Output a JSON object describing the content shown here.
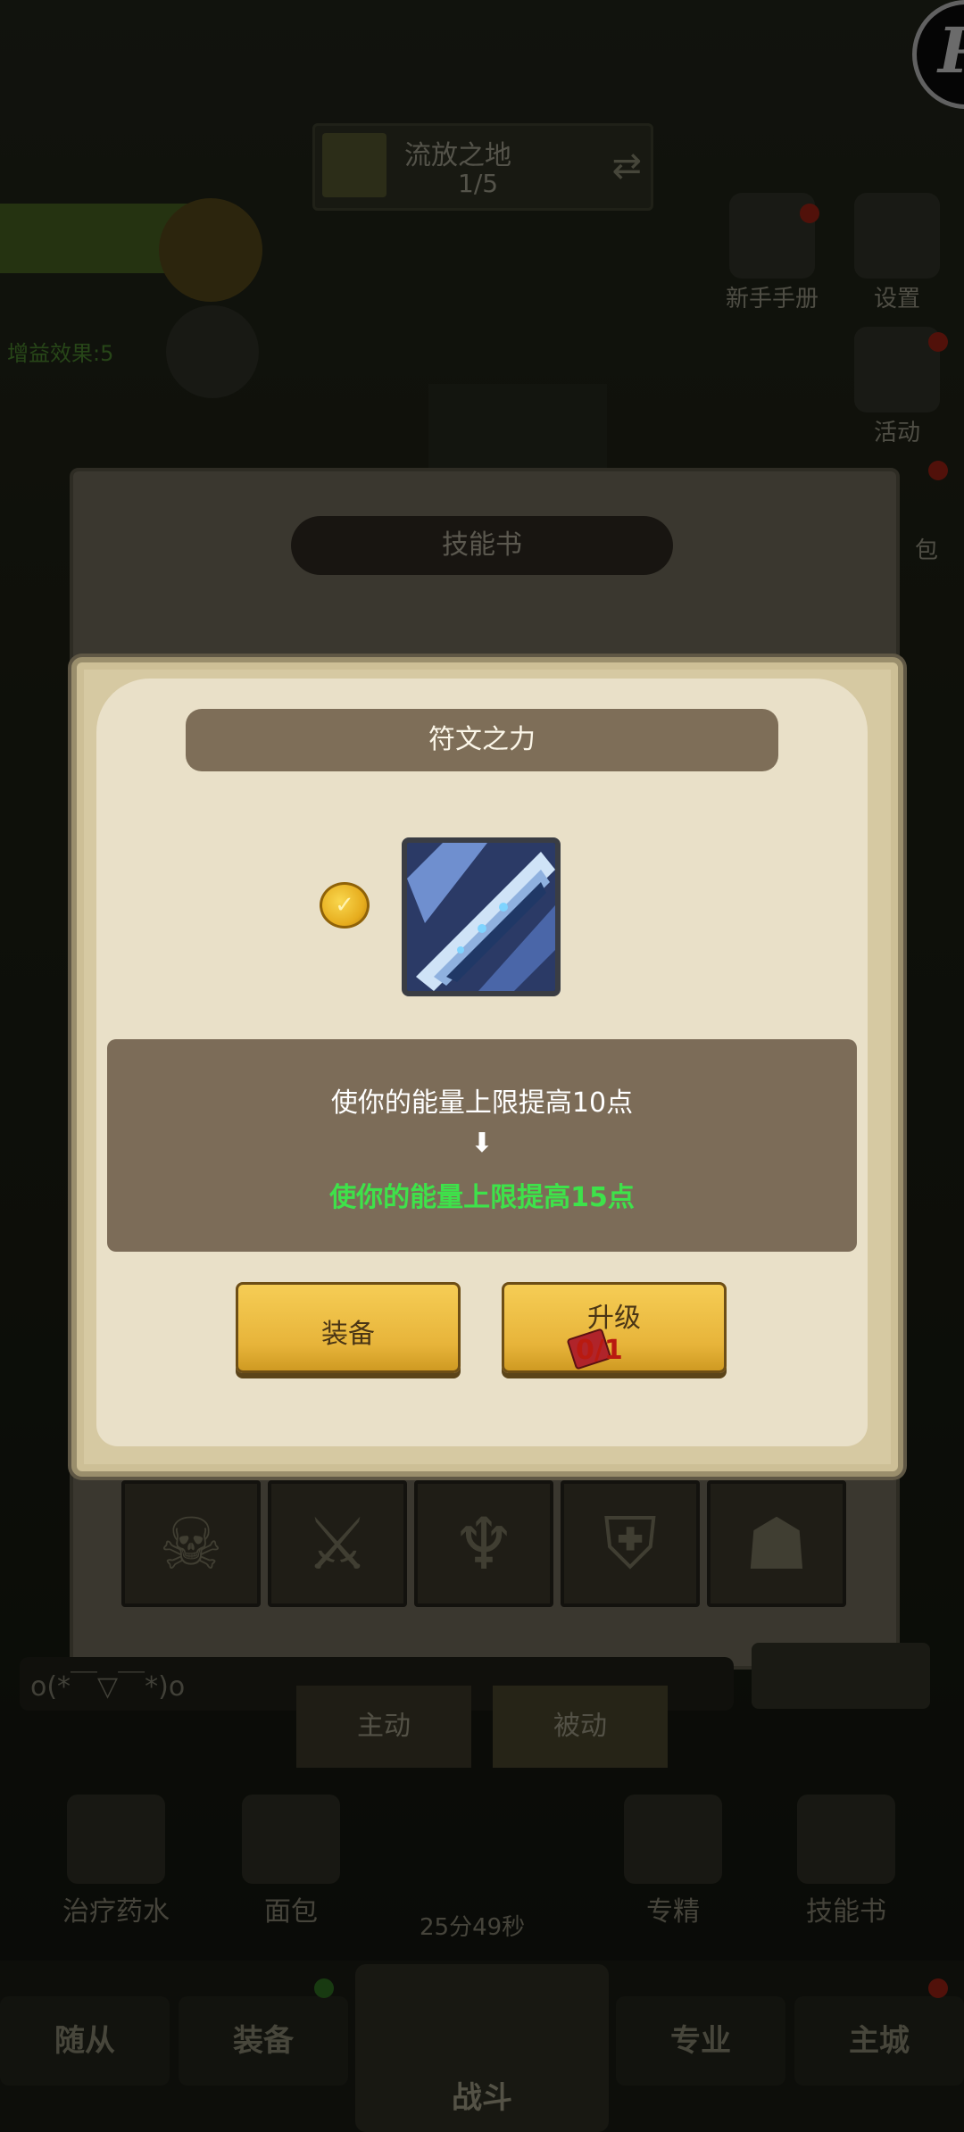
{
  "background": {
    "stage": {
      "name": "流放之地",
      "progress": "1/5"
    },
    "top_right": [
      {
        "label": "新手手册",
        "icon": "book-icon"
      },
      {
        "label": "设置",
        "icon": "gear-icon"
      },
      {
        "label": "活动",
        "icon": "calendar-icon"
      },
      {
        "label": "包",
        "icon": "bag-icon"
      }
    ],
    "green_text": "增益效果:5",
    "back_panel_title": "技能书",
    "skill_slots": [
      {
        "icon": "skull-icon"
      },
      {
        "icon": "sword-icon"
      },
      {
        "icon": "demon-icon"
      },
      {
        "icon": "shield-icon"
      },
      {
        "icon": "bone-icon"
      }
    ],
    "chat_text": "o(*￣▽￣*)o",
    "skill_tabs": {
      "active": "主动",
      "passive": "被动"
    },
    "tools": [
      {
        "label": "治疗药水",
        "icon": "potion-icon"
      },
      {
        "label": "面包",
        "icon": "bread-icon"
      },
      {
        "label": "专精",
        "icon": "target-icon"
      },
      {
        "label": "技能书",
        "icon": "spellbook-icon"
      }
    ],
    "timer": "25分49秒",
    "nav": {
      "companion": "随从",
      "equipment": "装备",
      "battle": "战斗",
      "profession": "专业",
      "city": "主城"
    }
  },
  "dialog": {
    "title": "符文之力",
    "skill_icon": "rune-blade-icon",
    "current_effect": "使你的能量上限提高10点",
    "arrow": "down-arrow",
    "next_effect": "使你的能量上限提高15点",
    "equip_label": "装备",
    "upgrade_label": "升级",
    "upgrade_cost": "0/1",
    "colors": {
      "next_effect": "#3ee24a",
      "cost": "#b91a10",
      "button": "#e7b43a"
    }
  }
}
